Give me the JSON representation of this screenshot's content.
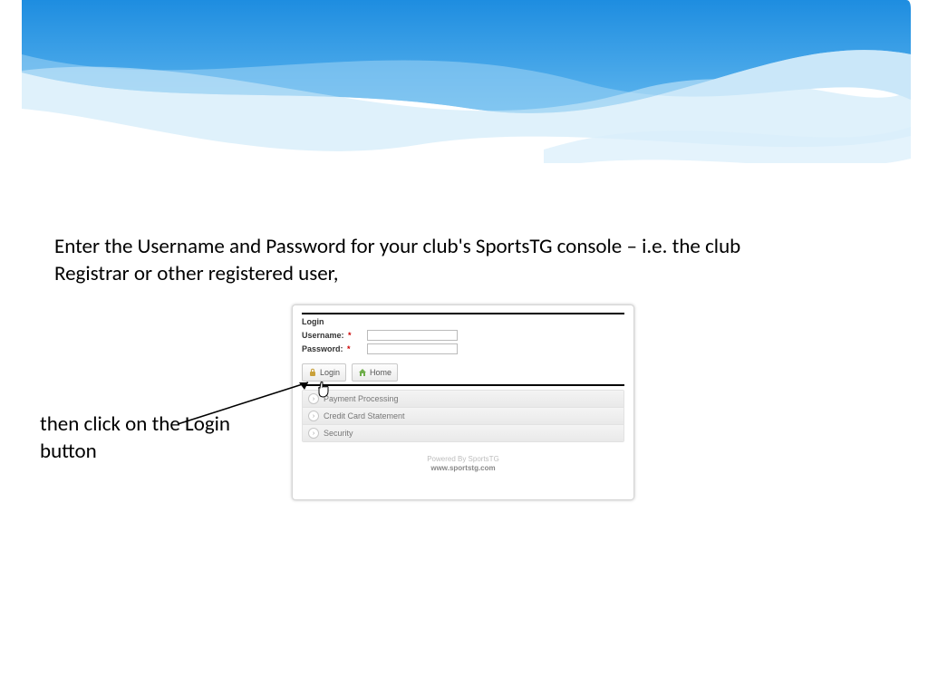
{
  "instructions": {
    "line1": "Enter the Username and Password for your club's SportsTG console – i.e. the club Registrar or other registered user,",
    "line2": "then click on the Login button"
  },
  "login_panel": {
    "heading": "Login",
    "username_label": "Username:",
    "password_label": "Password:",
    "required_marker": "*",
    "login_button": "Login",
    "home_button": "Home",
    "accordion": {
      "items": [
        "Payment Processing",
        "Credit Card Statement",
        "Security"
      ]
    },
    "footer": {
      "powered": "Powered By SportsTG",
      "url": "www.sportstg.com"
    }
  }
}
